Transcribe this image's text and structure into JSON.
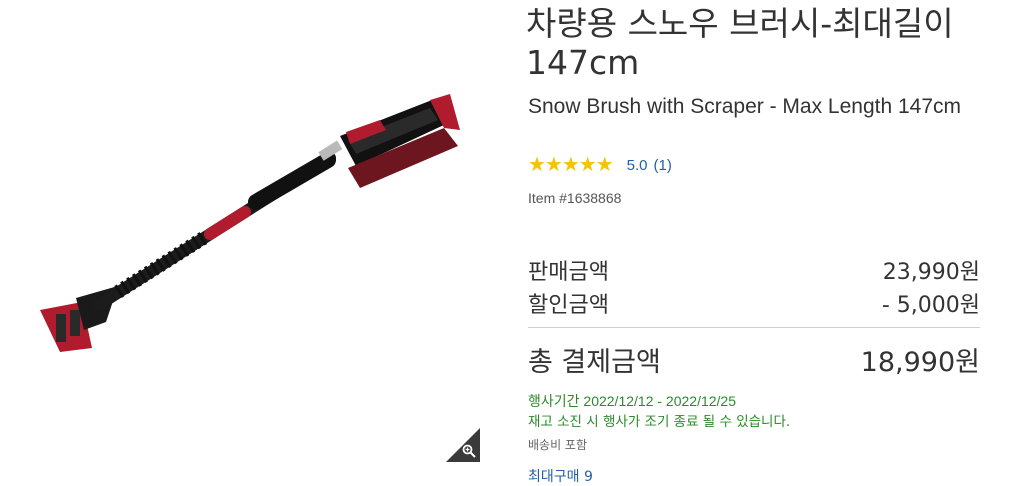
{
  "product": {
    "title_ko": "차량용 스노우 브러시-최대길이147cm",
    "title_en": "Snow Brush with Scraper - Max Length 147cm",
    "rating_stars": "★★★★★",
    "rating_score": "5.0",
    "rating_count": "(1)",
    "item_number": "Item #1638868"
  },
  "pricing": {
    "sale_label": "판매금액",
    "sale_value": "23,990원",
    "discount_label": "할인금액",
    "discount_value": "- 5,000원",
    "total_label": "총 결제금액",
    "total_value": "18,990원"
  },
  "promo": {
    "period": "행사기간 2022/12/12 - 2022/12/25",
    "notice": "재고 소진 시 행사가 조기 종료 될 수 있습니다.",
    "shipping": "배송비 포함",
    "max_purchase": "최대구매 9"
  },
  "colors": {
    "accent_red": "#b01c2e",
    "link_blue": "#2460a7",
    "promo_green": "#2b8a2b",
    "star_gold": "#f4c400"
  },
  "icons": {
    "zoom": "zoom-in-icon"
  }
}
